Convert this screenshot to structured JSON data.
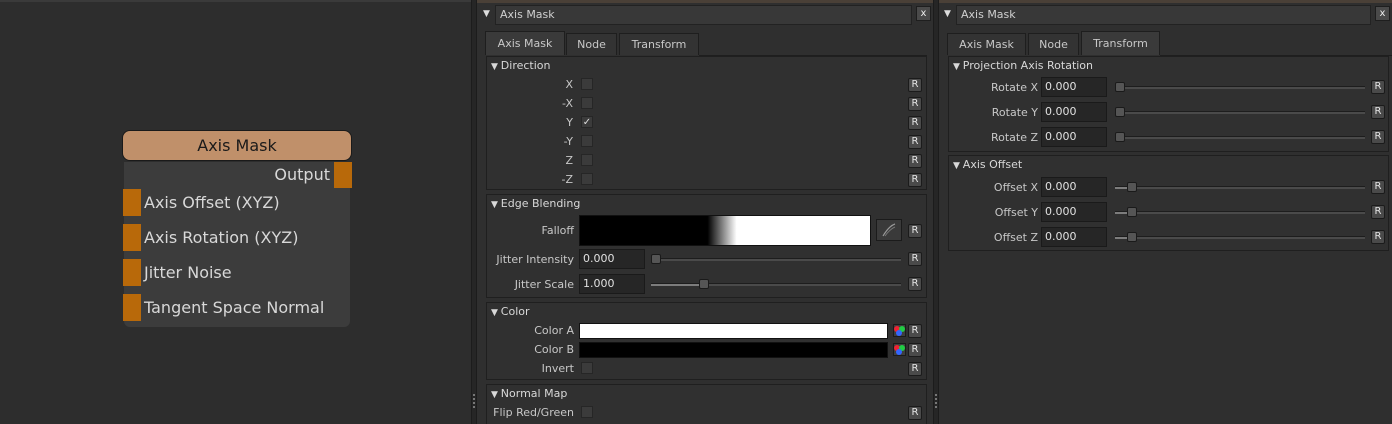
{
  "node": {
    "title": "Axis Mask",
    "output_label": "Output",
    "inputs": [
      "Axis Offset (XYZ)",
      "Axis Rotation (XYZ)",
      "Jitter Noise",
      "Tangent Space Normal"
    ]
  },
  "panels": [
    {
      "title": "Axis Mask",
      "close_label": "x",
      "tabs": [
        {
          "label": "Axis Mask",
          "active": true
        },
        {
          "label": "Node",
          "active": false
        },
        {
          "label": "Transform",
          "active": false
        }
      ],
      "groups": {
        "direction": {
          "title": "Direction",
          "rows": [
            {
              "label": "X",
              "checked": false
            },
            {
              "label": "-X",
              "checked": false
            },
            {
              "label": "Y",
              "checked": true
            },
            {
              "label": "-Y",
              "checked": false
            },
            {
              "label": "Z",
              "checked": false
            },
            {
              "label": "-Z",
              "checked": false
            }
          ]
        },
        "edge_blending": {
          "title": "Edge Blending",
          "falloff_label": "Falloff",
          "jitter_intensity": {
            "label": "Jitter Intensity",
            "value": "0.000",
            "level": 0
          },
          "jitter_scale": {
            "label": "Jitter Scale",
            "value": "1.000",
            "level": 0.2
          }
        },
        "color": {
          "title": "Color",
          "color_a": {
            "label": "Color A",
            "color": "#ffffff"
          },
          "color_b": {
            "label": "Color B",
            "color": "#000000"
          },
          "invert": {
            "label": "Invert",
            "checked": false
          }
        },
        "normal_map": {
          "title": "Normal Map",
          "flip": {
            "label": "Flip Red/Green",
            "checked": false
          }
        }
      },
      "reset_label": "R"
    },
    {
      "title": "Axis Mask",
      "close_label": "x",
      "tabs": [
        {
          "label": "Axis Mask",
          "active": false
        },
        {
          "label": "Node",
          "active": false
        },
        {
          "label": "Transform",
          "active": true
        }
      ],
      "groups": {
        "rotation": {
          "title": "Projection Axis Rotation",
          "rows": [
            {
              "label": "Rotate X",
              "value": "0.000",
              "level": 0
            },
            {
              "label": "Rotate Y",
              "value": "0.000",
              "level": 0
            },
            {
              "label": "Rotate Z",
              "value": "0.000",
              "level": 0
            }
          ]
        },
        "offset": {
          "title": "Axis Offset",
          "rows": [
            {
              "label": "Offset X",
              "value": "0.000",
              "level": 0.05
            },
            {
              "label": "Offset Y",
              "value": "0.000",
              "level": 0.05
            },
            {
              "label": "Offset Z",
              "value": "0.000",
              "level": 0.05
            }
          ]
        }
      },
      "reset_label": "R"
    }
  ]
}
